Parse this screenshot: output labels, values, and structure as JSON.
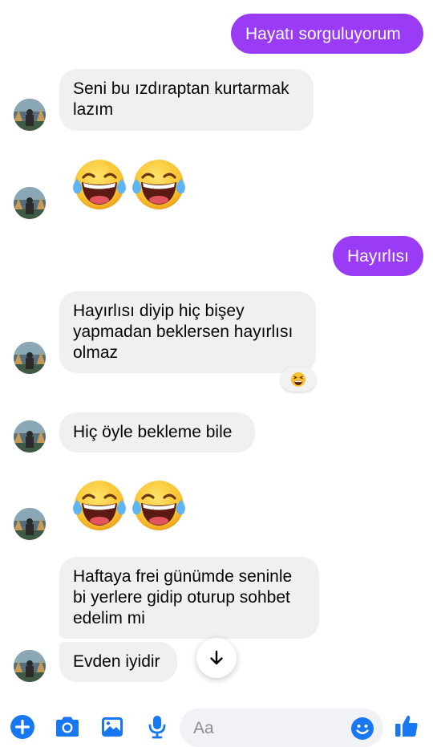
{
  "messages": {
    "out_1": "Hayatı sorguluyorum",
    "in_1": "Seni bu ızdıraptan kurtarmak\nlazım",
    "out_2": "Hayırlısı",
    "in_2": "Hayırlısı diyip hiç bişey\nyapmadan beklersen hayırlısı\nolmaz",
    "in_3": "Hiç öyle bekleme bile",
    "in_4": "Haftaya frei günümde seninle\nbi yerlere gidip oturup sohbet\nedelim mi",
    "in_5": "Evden iyidir"
  },
  "emojis": {
    "name": "face-with-tears-of-joy",
    "reaction_name": "grinning-squinting-face"
  },
  "composer": {
    "placeholder": "Aa",
    "icons": [
      "plus-icon",
      "camera-icon",
      "image-icon",
      "microphone-icon",
      "smile-icon",
      "thumbs-up-icon"
    ]
  },
  "colors": {
    "outgoing_bubble": "#9a3cf5",
    "incoming_bubble": "#f0f0f0",
    "accent_blue": "#1877f2"
  }
}
